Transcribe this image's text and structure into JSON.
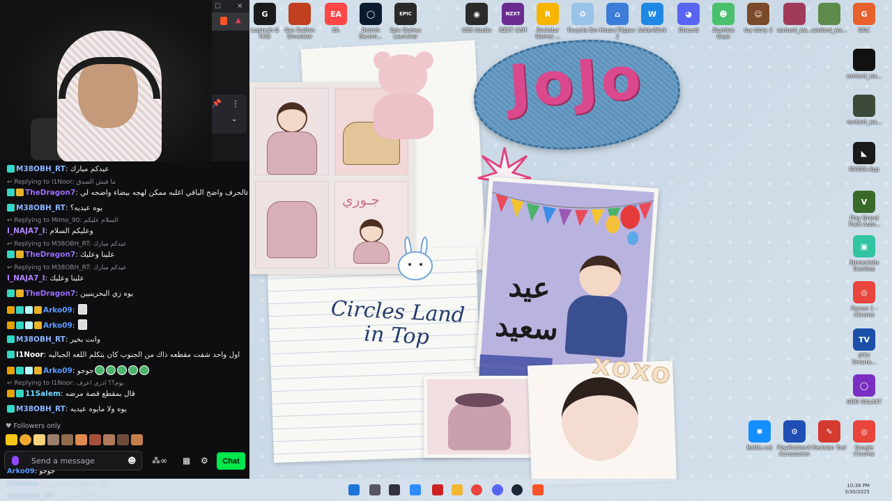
{
  "desktop": {
    "top_icons": [
      {
        "label": "Logitech G HUB",
        "icon": "logitech-icon",
        "color": "#1a1a1a",
        "glyph": "G"
      },
      {
        "label": "Gas Station Simulator",
        "icon": "gas-station-icon",
        "color": "#c04020",
        "glyph": ""
      },
      {
        "label": "EA",
        "icon": "ea-icon",
        "color": "#ff4747",
        "glyph": "EA"
      },
      {
        "label": "Detroit Becom...",
        "icon": "detroit-icon",
        "color": "#0a1b2e",
        "glyph": "◯"
      },
      {
        "label": "Epic Games Launcher",
        "icon": "epic-icon",
        "color": "#2a2a2a",
        "glyph": "EPIC"
      },
      {
        "label": "OBS Studio",
        "icon": "obs-icon",
        "color": "#2b2b2b",
        "glyph": "◉"
      },
      {
        "label": "NZXT CAM",
        "icon": "nzxt-icon",
        "color": "#6a2c91",
        "glyph": "NZXT"
      },
      {
        "label": "Rockstar Games ...",
        "icon": "rockstar-icon",
        "color": "#f7b500",
        "glyph": "R"
      },
      {
        "label": "Recycle Bin",
        "icon": "recycle-bin-icon",
        "color": "#9ac3e8",
        "glyph": "♻"
      },
      {
        "label": "House Flipper 2",
        "icon": "house-icon",
        "color": "#3b7dd8",
        "glyph": "⌂"
      },
      {
        "label": "AnkerWork",
        "icon": "ankerwork-icon",
        "color": "#1e88e5",
        "glyph": "W"
      },
      {
        "label": "Discord",
        "icon": "discord-icon",
        "color": "#5865f2",
        "glyph": "◕"
      },
      {
        "label": "Stumble Guys",
        "icon": "stumble-icon",
        "color": "#49c06b",
        "glyph": "☻"
      },
      {
        "label": "toy story 3",
        "icon": "toy-story-icon",
        "color": "#7b4a28",
        "glyph": "☺"
      },
      {
        "label": "content_wa...",
        "icon": "image-file-icon",
        "color": "#a03c5a",
        "glyph": ""
      },
      {
        "label": "content_wa...",
        "icon": "image-file-icon",
        "color": "#5e8a4c",
        "glyph": ""
      },
      {
        "label": "GGC",
        "icon": "ggc-icon",
        "color": "#e8602c",
        "glyph": "G"
      }
    ],
    "right_icons": [
      {
        "label": "content_wa...",
        "icon": "image-file-icon",
        "color": "#111111",
        "glyph": ""
      },
      {
        "label": "content_wa...",
        "icon": "image-file-icon",
        "color": "#3d4a3a",
        "glyph": ""
      },
      {
        "label": "NVIDIA App",
        "icon": "nvidia-icon",
        "color": "#1a1a1a",
        "glyph": "◣"
      },
      {
        "label": "Play Grand Theft Auto...",
        "icon": "gta-icon",
        "color": "#3a6a2a",
        "glyph": "V"
      },
      {
        "label": "Streamlabs Desktop",
        "icon": "streamlabs-icon",
        "color": "#31c3a2",
        "glyph": "▣"
      },
      {
        "label": "Person 1 - Chrome",
        "icon": "chrome-icon",
        "color": "#e8453c",
        "glyph": "◎"
      },
      {
        "label": "IPTV Smarte...",
        "icon": "iptv-icon",
        "color": "#1b4fa8",
        "glyph": "TV"
      },
      {
        "label": "GOG GALAXY",
        "icon": "gog-icon",
        "color": "#7a2fc2",
        "glyph": "◯"
      }
    ],
    "bottom_icons": [
      {
        "label": "Battle.net",
        "icon": "battlenet-icon",
        "color": "#148eff",
        "glyph": "✺"
      },
      {
        "label": "PlayStation® Accessories",
        "icon": "playstation-icon",
        "color": "#1f4fb5",
        "glyph": "⚙"
      },
      {
        "label": "Revision Tool",
        "icon": "revision-tool-icon",
        "color": "#d43a2f",
        "glyph": "✎"
      },
      {
        "label": "Google Chrome",
        "icon": "chrome-icon",
        "color": "#e8453c",
        "glyph": "◎"
      }
    ]
  },
  "wallpaper": {
    "jojo": "JoJo",
    "circles_land": "Circles Land\nin Top",
    "eid_text": "عيد\nسعيد",
    "xoxo": "xoxo",
    "photo_caption": "جـوري"
  },
  "chat": {
    "messages": [
      {
        "type": "msg",
        "badges": [
          "cyan"
        ],
        "user": "M38OBH_RT",
        "user_color": "#8ab4ff",
        "text": "عيدكم مبارك",
        "emotes": 0
      },
      {
        "type": "reply",
        "text": "Replying to I1Noor: ما فيش الصدق"
      },
      {
        "type": "msg",
        "badges": [
          "cyan",
          "gold"
        ],
        "user": "TheDragon7",
        "user_color": "#9b6bff",
        "text": "بس هالحرف واضح الباقي اغلبه ممكن لهجه بيضاء واضحه لي",
        "emotes": 0
      },
      {
        "type": "msg",
        "badges": [
          "cyan"
        ],
        "user": "M38OBH_RT",
        "user_color": "#8ab4ff",
        "text": "يوه عيديه؟",
        "emotes": 0
      },
      {
        "type": "reply",
        "text": "Replying to Mimo_90: السلام عليكم"
      },
      {
        "type": "msg",
        "badges": [],
        "user": "I_NAJA7_I",
        "user_color": "#b283ff",
        "text": "وعليكم السلام",
        "emotes": 0
      },
      {
        "type": "reply",
        "text": "Replying to M38OBH_RT: عيدكم مبارك"
      },
      {
        "type": "msg",
        "badges": [
          "cyan",
          "gold"
        ],
        "user": "TheDragon7",
        "user_color": "#9b6bff",
        "text": "علينا وعليك",
        "emotes": 0
      },
      {
        "type": "reply",
        "text": "Replying to M38OBH_RT: عيدكم مبارك"
      },
      {
        "type": "msg",
        "badges": [],
        "user": "I_NAJA7_I",
        "user_color": "#b283ff",
        "text": "علينا وعليك",
        "emotes": 0
      },
      {
        "type": "msg",
        "badges": [
          "cyan",
          "gold"
        ],
        "user": "TheDragon7",
        "user_color": "#9b6bff",
        "text": "يوه زي البحرينيين",
        "emotes": 0
      },
      {
        "type": "msg",
        "badges": [
          "crown",
          "cyan",
          "sub",
          "gold"
        ],
        "user": "Arko09",
        "user_color": "#5a9bff",
        "text": "",
        "emotes": 1,
        "square": true
      },
      {
        "type": "msg",
        "badges": [
          "crown",
          "cyan",
          "sub",
          "gold"
        ],
        "user": "Arko09",
        "user_color": "#5a9bff",
        "text": "",
        "emotes": 1,
        "square": true
      },
      {
        "type": "msg",
        "badges": [
          "cyan"
        ],
        "user": "M38OBH_RT",
        "user_color": "#8ab4ff",
        "text": "وانت بخير",
        "emotes": 0
      },
      {
        "type": "msg",
        "badges": [
          "cyan"
        ],
        "user": "I1Noor",
        "user_color": "#ffffff",
        "text": "اول واحد شفت مقطعه ذاك من الجنوب كان يتكلم اللغه الجباليه",
        "emotes": 0
      },
      {
        "type": "msg",
        "badges": [
          "crown",
          "cyan",
          "sub",
          "gold"
        ],
        "user": "Arko09",
        "user_color": "#5a9bff",
        "text": "جوجو",
        "emotes": 5
      },
      {
        "type": "reply",
        "text": "Replying to I1Noor: يوم؟؟ ادري اعرف"
      },
      {
        "type": "msg",
        "badges": [
          "crown",
          "cyan"
        ],
        "user": "11Salem",
        "user_color": "#6fd6ff",
        "text": "قال بمقطع قصة مرضه",
        "emotes": 0
      },
      {
        "type": "msg",
        "badges": [
          "cyan"
        ],
        "user": "M38OBH_RT",
        "user_color": "#8ab4ff",
        "text": "يوه ولا مايوه عيديه",
        "emotes": 0
      }
    ],
    "followers_only": "Followers only",
    "placeholder": "Send a message",
    "chat_button": "Chat",
    "bits_label": "∞"
  },
  "under_overlay": [
    {
      "user": "Arko09",
      "user_color": "#5a9bff",
      "text": "جوجو"
    },
    {
      "user": "I1Salem",
      "user_color": "#6fd6ff",
      "text": "قال بمقطع قصة مرضه"
    },
    {
      "user": "M38OBH_RT",
      "user_color": "#8ab4ff",
      "text": "يوه ولا مايوه عيديه"
    }
  ],
  "taskbar": {
    "icons": [
      "windows-start-icon",
      "search-icon",
      "task-view-icon",
      "widgets-icon",
      "app-icon",
      "file-explorer-icon",
      "chrome-icon",
      "discord-icon",
      "steam-icon",
      "brave-icon"
    ],
    "tray_time": "10:38 PM",
    "tray_date": "3/30/2025"
  }
}
